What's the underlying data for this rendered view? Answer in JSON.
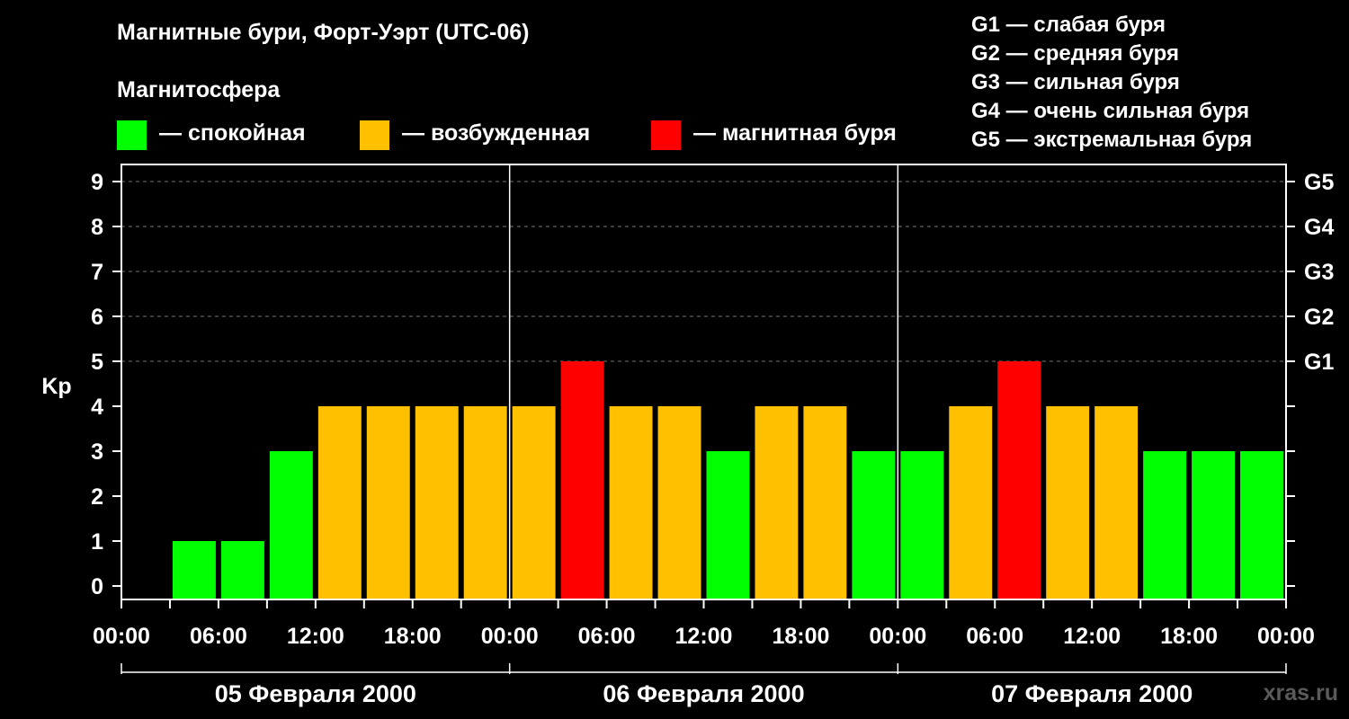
{
  "title": "Магнитные бури, Форт-Уэрт (UTC-06)",
  "magnetosphere": {
    "heading": "Магнитосфера",
    "items": [
      {
        "label": "— спокойная",
        "color": "#00ff00"
      },
      {
        "label": "— возбужденная",
        "color": "#ffc000"
      },
      {
        "label": "— магнитная буря",
        "color": "#ff0000"
      }
    ]
  },
  "g_legend": [
    "G1 — слабая буря",
    "G2 — средняя буря",
    "G3 — сильная буря",
    "G4 — очень сильная буря",
    "G5 — экстремальная буря"
  ],
  "watermark": "xras.ru",
  "chart_data": {
    "type": "bar",
    "ylabel": "Kp",
    "ylim": [
      0,
      9
    ],
    "y_ticks": [
      "0",
      "1",
      "2",
      "3",
      "4",
      "5",
      "6",
      "7",
      "8",
      "9"
    ],
    "right_ticks": [
      {
        "kp": 5,
        "label": "G1"
      },
      {
        "kp": 6,
        "label": "G2"
      },
      {
        "kp": 7,
        "label": "G3"
      },
      {
        "kp": 8,
        "label": "G4"
      },
      {
        "kp": 9,
        "label": "G5"
      }
    ],
    "x_tick_labels": [
      "00:00",
      "06:00",
      "12:00",
      "18:00",
      "00:00",
      "06:00",
      "12:00",
      "18:00",
      "00:00",
      "06:00",
      "12:00",
      "18:00",
      "00:00"
    ],
    "days": [
      "05 Февраля 2000",
      "06 Февраля 2000",
      "07 Февраля 2000"
    ],
    "interval_hours": 3,
    "values": [
      0,
      1,
      1,
      3,
      4,
      4,
      4,
      4,
      4,
      5,
      4,
      4,
      3,
      4,
      4,
      3,
      3,
      4,
      5,
      4,
      4,
      3,
      3,
      3
    ],
    "colors": {
      "quiet": "#00ff00",
      "unsettled": "#ffc000",
      "storm": "#ff0000"
    },
    "grid": "dashed horizontal at Kp 5–9",
    "legend_placement": "top"
  }
}
